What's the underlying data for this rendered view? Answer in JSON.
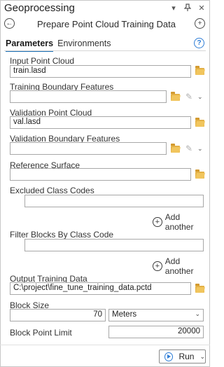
{
  "pane": {
    "title": "Geoprocessing",
    "menu_icon": "▾",
    "pin_icon": "pin-icon",
    "close_icon": "×"
  },
  "tool": {
    "title": "Prepare Point Cloud Training Data"
  },
  "tabs": [
    {
      "label": "Parameters",
      "active": true
    },
    {
      "label": "Environments",
      "active": false
    }
  ],
  "help_glyph": "?",
  "params": {
    "input_point_cloud": {
      "label": "Input Point Cloud",
      "value": "train.lasd"
    },
    "training_boundary": {
      "label": "Training Boundary Features",
      "value": ""
    },
    "validation_point_cloud": {
      "label": "Validation Point Cloud",
      "value": "val.lasd"
    },
    "validation_boundary": {
      "label": "Validation Boundary Features",
      "value": ""
    },
    "reference_surface": {
      "label": "Reference Surface",
      "value": ""
    },
    "excluded_class_codes": {
      "label": "Excluded Class Codes",
      "value": "",
      "add_label": "Add another"
    },
    "filter_blocks": {
      "label": "Filter Blocks By Class Code",
      "value": "",
      "add_label": "Add another"
    },
    "output_training_data": {
      "label": "Output Training Data",
      "value": "C:\\project\\fine_tune_training_data.pctd"
    },
    "block_size": {
      "label": "Block Size",
      "value": "70",
      "unit": "Meters"
    },
    "block_point_limit": {
      "label": "Block Point Limit",
      "value": "20000"
    }
  },
  "run": {
    "label": "Run"
  },
  "colors": {
    "accent": "#1c72b8",
    "folder": "#e3b045"
  }
}
